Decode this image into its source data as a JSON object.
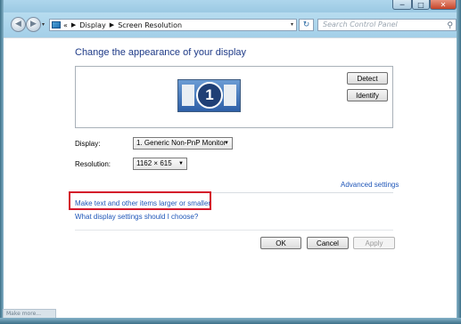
{
  "window": {
    "minimize_glyph": "─",
    "maximize_glyph": "□",
    "close_glyph": "✕"
  },
  "nav": {
    "back_glyph": "◀",
    "forward_glyph": "▶",
    "dropdown_glyph": "▾",
    "breadcrumb_root": "«",
    "breadcrumb": [
      "Display",
      "Screen Resolution"
    ],
    "refresh_glyph": "↻",
    "search_placeholder": "Search Control Panel",
    "search_glyph": "⚲"
  },
  "main": {
    "heading": "Change the appearance of your display",
    "monitor_number": "1",
    "detect_label": "Detect",
    "identify_label": "Identify",
    "display_label": "Display:",
    "display_value": "1. Generic Non-PnP Monitor",
    "resolution_label": "Resolution:",
    "resolution_value": "1162 × 615",
    "advanced_settings_link": "Advanced settings",
    "text_size_link": "Make text and other items larger or smaller",
    "help_link": "What display settings should I choose?",
    "ok_label": "OK",
    "cancel_label": "Cancel",
    "apply_label": "Apply"
  },
  "colors": {
    "heading": "#1e3a87",
    "link": "#1f56b8",
    "highlight": "#d4142a",
    "titlebar": "#aed6ec"
  },
  "icons": {
    "address": "control-panel-icon",
    "search": "search-icon",
    "refresh": "refresh-icon",
    "monitor": "monitor-icon"
  },
  "status_tab": "Make more..."
}
